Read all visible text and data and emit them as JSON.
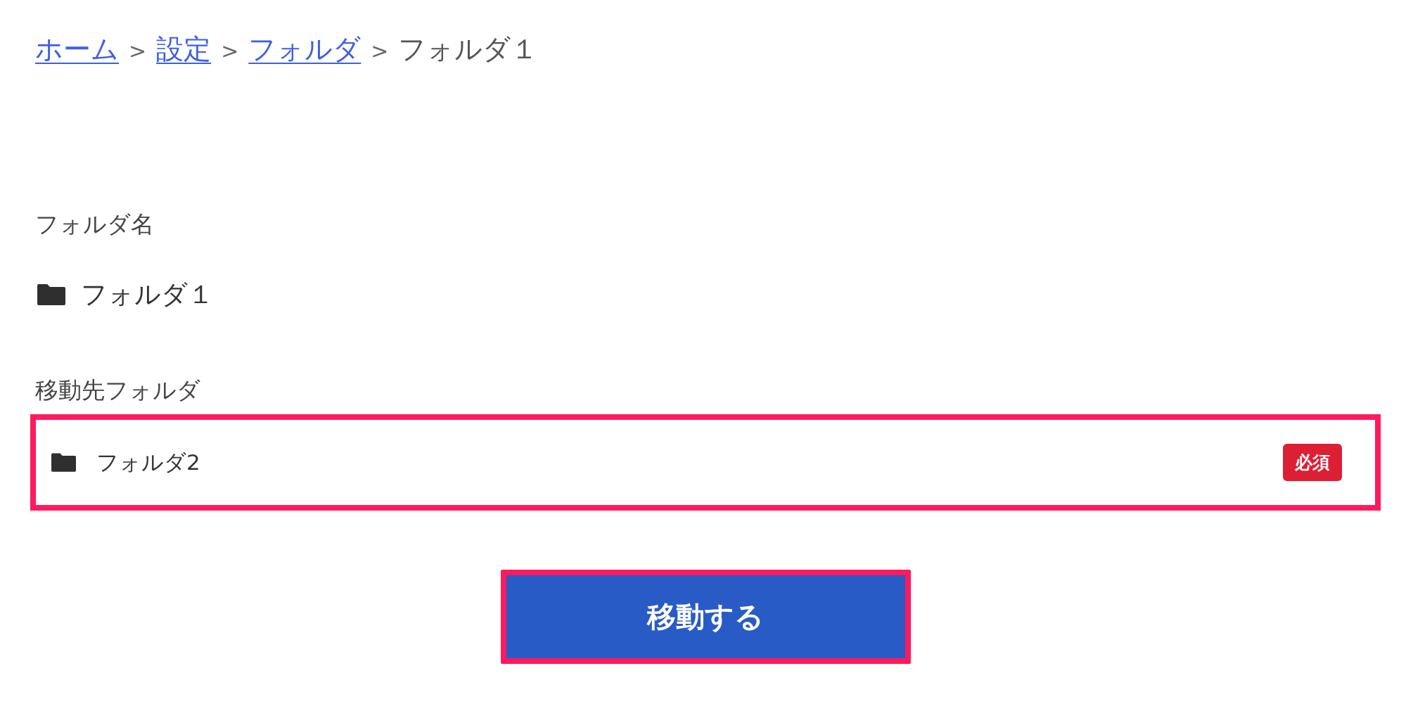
{
  "breadcrumb": [
    {
      "kind": "link",
      "text": "ホーム"
    },
    {
      "kind": "separator",
      "text": ">"
    },
    {
      "kind": "link",
      "text": "設定"
    },
    {
      "kind": "separator",
      "text": ">"
    },
    {
      "kind": "link",
      "text": "フォルダ"
    },
    {
      "kind": "separator",
      "text": ">"
    },
    {
      "kind": "current",
      "text": "フォルダ１"
    }
  ],
  "folder_name": {
    "label": "フォルダ名",
    "value": "フォルダ１"
  },
  "destination": {
    "label": "移動先フォルダ",
    "value": "フォルダ2",
    "badge": "必須",
    "highlighted": true
  },
  "submit_button": {
    "label": "移動する",
    "highlighted": true
  }
}
